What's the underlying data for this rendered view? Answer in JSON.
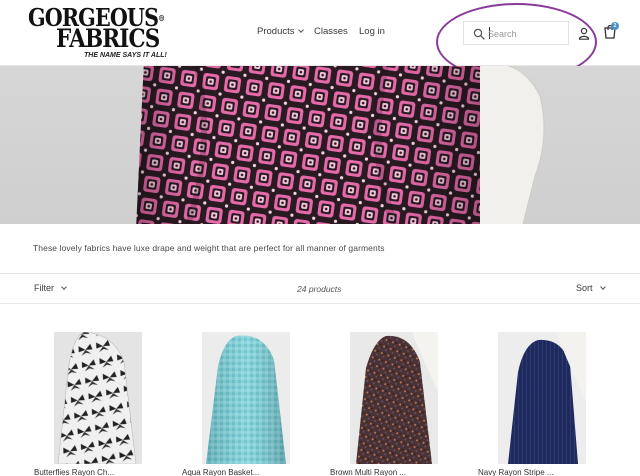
{
  "brand": {
    "logo_line1": "GORGEOUS",
    "logo_line2": "FABRICS",
    "logo_registered": "®",
    "tagline": "THE NAME SAYS IT ALL!"
  },
  "nav": {
    "products": "Products",
    "classes": "Classes",
    "login": "Log in"
  },
  "search": {
    "placeholder": "Search",
    "value": ""
  },
  "cart": {
    "count": "2"
  },
  "collection": {
    "description": "These lovely fabrics have luxe drape and weight that are perfect for all manner of garments",
    "filter_label": "Filter",
    "product_count": "24 products",
    "sort_label": "Sort"
  },
  "products": [
    {
      "title": "Butterflies Rayon Ch..."
    },
    {
      "title": "Aqua Rayon Basket..."
    },
    {
      "title": "Brown Multi Rayon ..."
    },
    {
      "title": "Navy Rayon Stripe ..."
    }
  ],
  "colors": {
    "accent_circle": "#8a3a9a",
    "cart_badge": "#4a90c8",
    "hero_background": "#d6d6d6",
    "fabric_pink": "#e46aa8",
    "fabric_dark": "#2a1a22"
  }
}
